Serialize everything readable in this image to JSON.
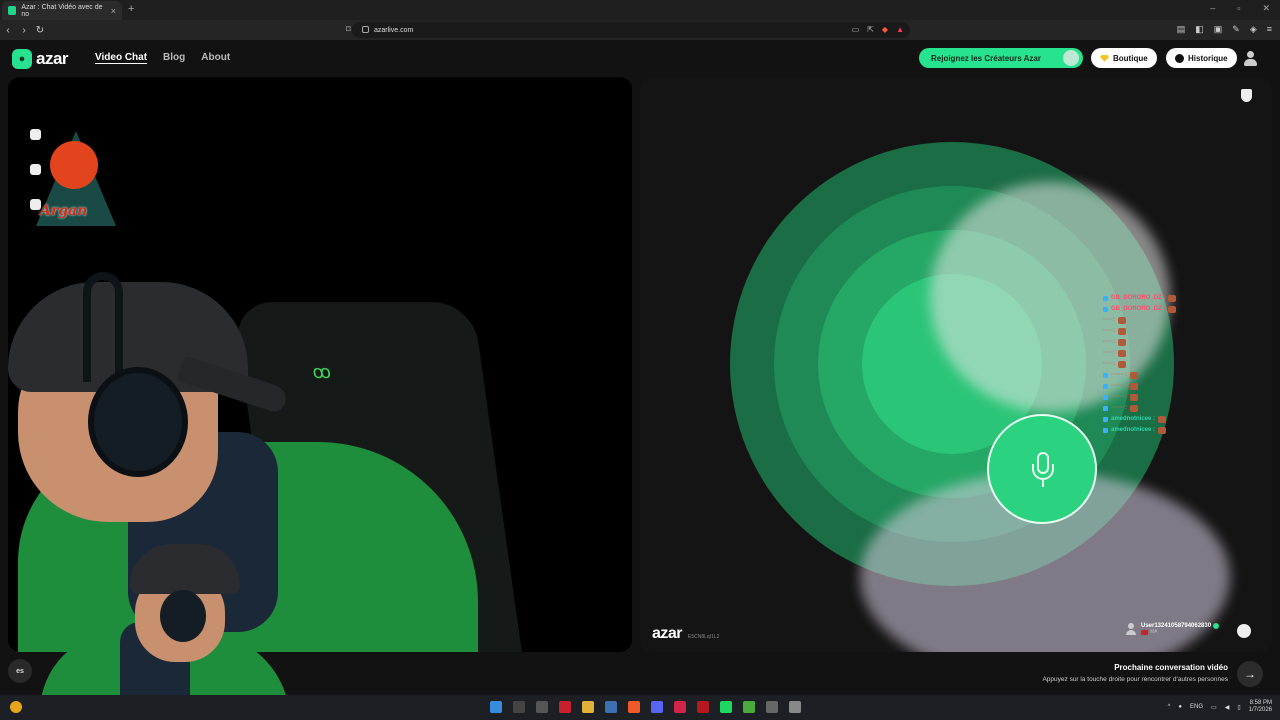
{
  "browser": {
    "tab_title": "Azar : Chat Vidéo avec de no",
    "tab_close": "×",
    "new_tab": "+",
    "url": "azarlive.com",
    "back": "‹",
    "forward": "›",
    "reload": "↻",
    "window_controls": [
      "–",
      "▫",
      "✕"
    ]
  },
  "header": {
    "logo_text": "azar",
    "nav": [
      "Video Chat",
      "Blog",
      "About"
    ],
    "creators_button": "Rejoignez les Créateurs Azar",
    "shop_button": "Boutique",
    "history_button": "Historique"
  },
  "overlay": {
    "stream_logo_text": "Argan"
  },
  "chat": [
    {
      "name": "GB_DORORO_DZ :",
      "color": "red",
      "badges": true
    },
    {
      "name": "GB_DORORO_DZ :",
      "color": "red",
      "badges": true
    },
    {
      "name": "·····:",
      "color": "red",
      "badges": false
    },
    {
      "name": "·····:",
      "color": "red",
      "badges": false
    },
    {
      "name": "·····:",
      "color": "red",
      "badges": false
    },
    {
      "name": "·····:",
      "color": "red",
      "badges": false
    },
    {
      "name": "·····:",
      "color": "red",
      "badges": false
    },
    {
      "name": "·······:",
      "color": "red",
      "badges": true
    },
    {
      "name": "·······:",
      "color": "red",
      "badges": true
    },
    {
      "name": "·······:",
      "color": "red",
      "badges": true
    },
    {
      "name": "·······:",
      "color": "red",
      "badges": true
    },
    {
      "name": "amednotnicee :",
      "color": "teal",
      "badges": true
    },
    {
      "name": "amednotnicee :",
      "color": "teal",
      "badges": true
    }
  ],
  "partner": {
    "brand": "azar",
    "session_code": "E5CN8LqI1L2",
    "username": "User13241058794062830",
    "country": "MA"
  },
  "next": {
    "title": "Prochaine conversation vidéo",
    "subtitle": "Appuyez sur la touche droite pour rencontrer d'autres personnes",
    "arrow": "→",
    "left_label": "es"
  },
  "taskbar": {
    "lang": "ENG",
    "time": "8:58 PM",
    "date": "1/7/2026"
  },
  "colors": {
    "accent": "#27e28f",
    "chat_red": "#ff4d6a",
    "chat_teal": "#2fd7b0"
  }
}
